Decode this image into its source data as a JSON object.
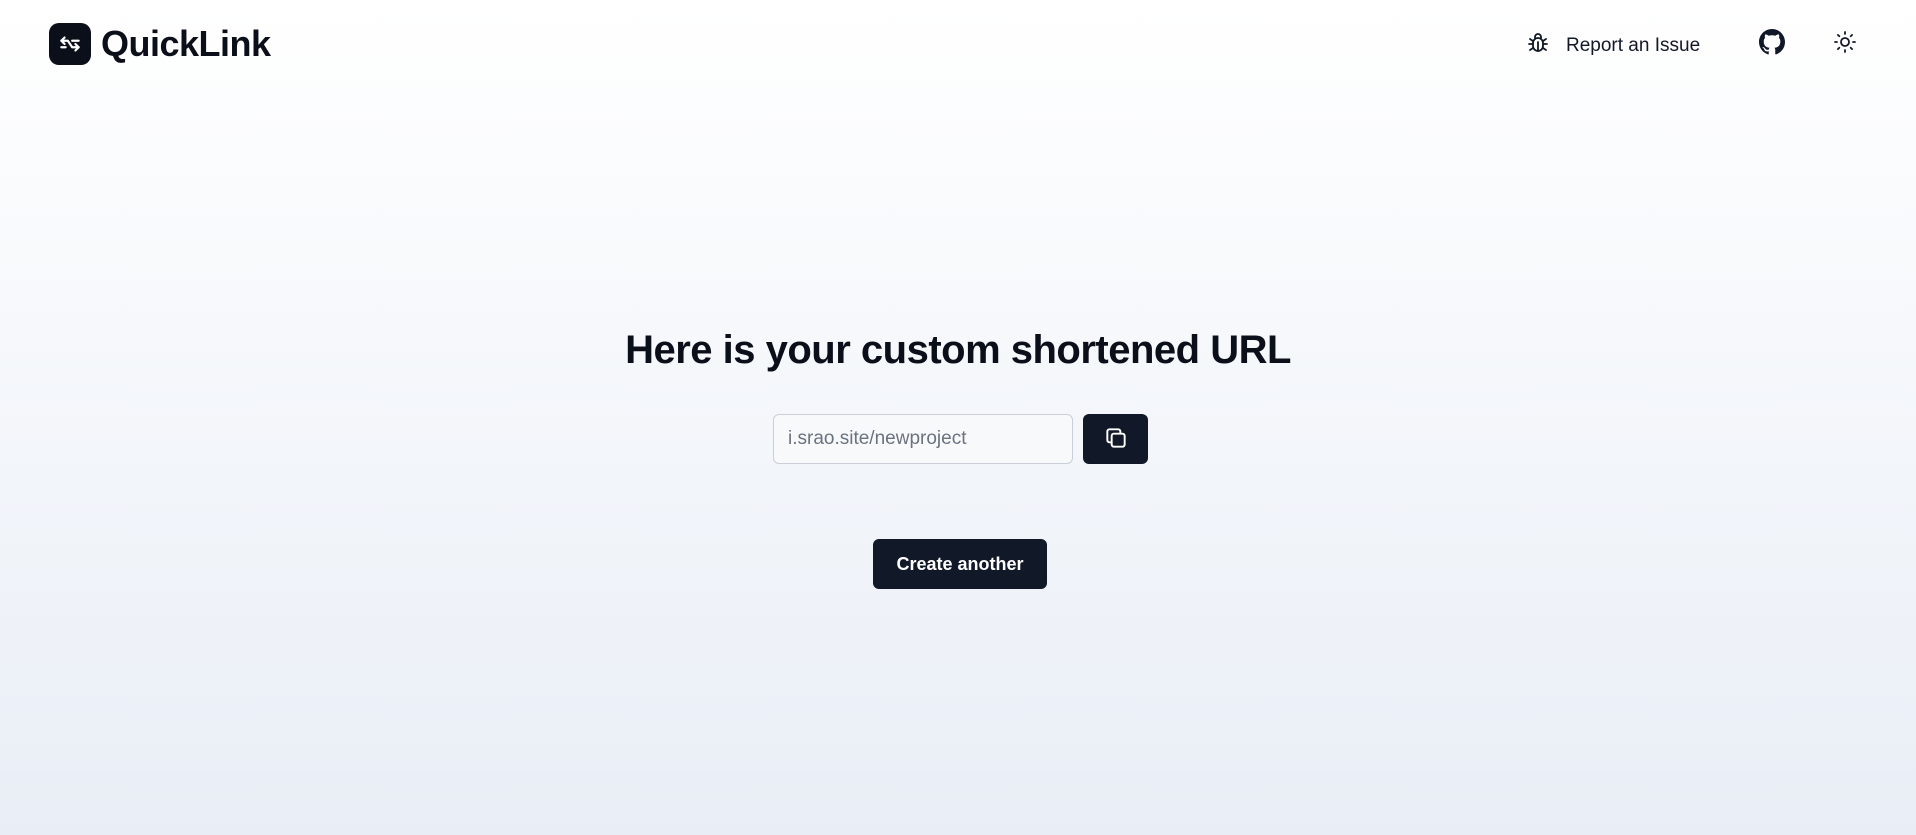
{
  "header": {
    "brand_name": "QuickLink",
    "logo_icon": "link-swap-icon",
    "report_label": "Report an Issue",
    "report_icon": "bug-icon",
    "github_icon": "github-icon",
    "theme_icon": "sun-icon"
  },
  "main": {
    "title": "Here is your custom shortened URL",
    "short_url_value": "i.srao.site/newproject",
    "copy_icon": "copy-icon",
    "create_another_label": "Create another"
  },
  "colors": {
    "primary": "#111827",
    "text": "#0b0f1a",
    "input_border": "#c9ced8",
    "background_top": "#ffffff",
    "background_bottom": "#e9eef6"
  }
}
